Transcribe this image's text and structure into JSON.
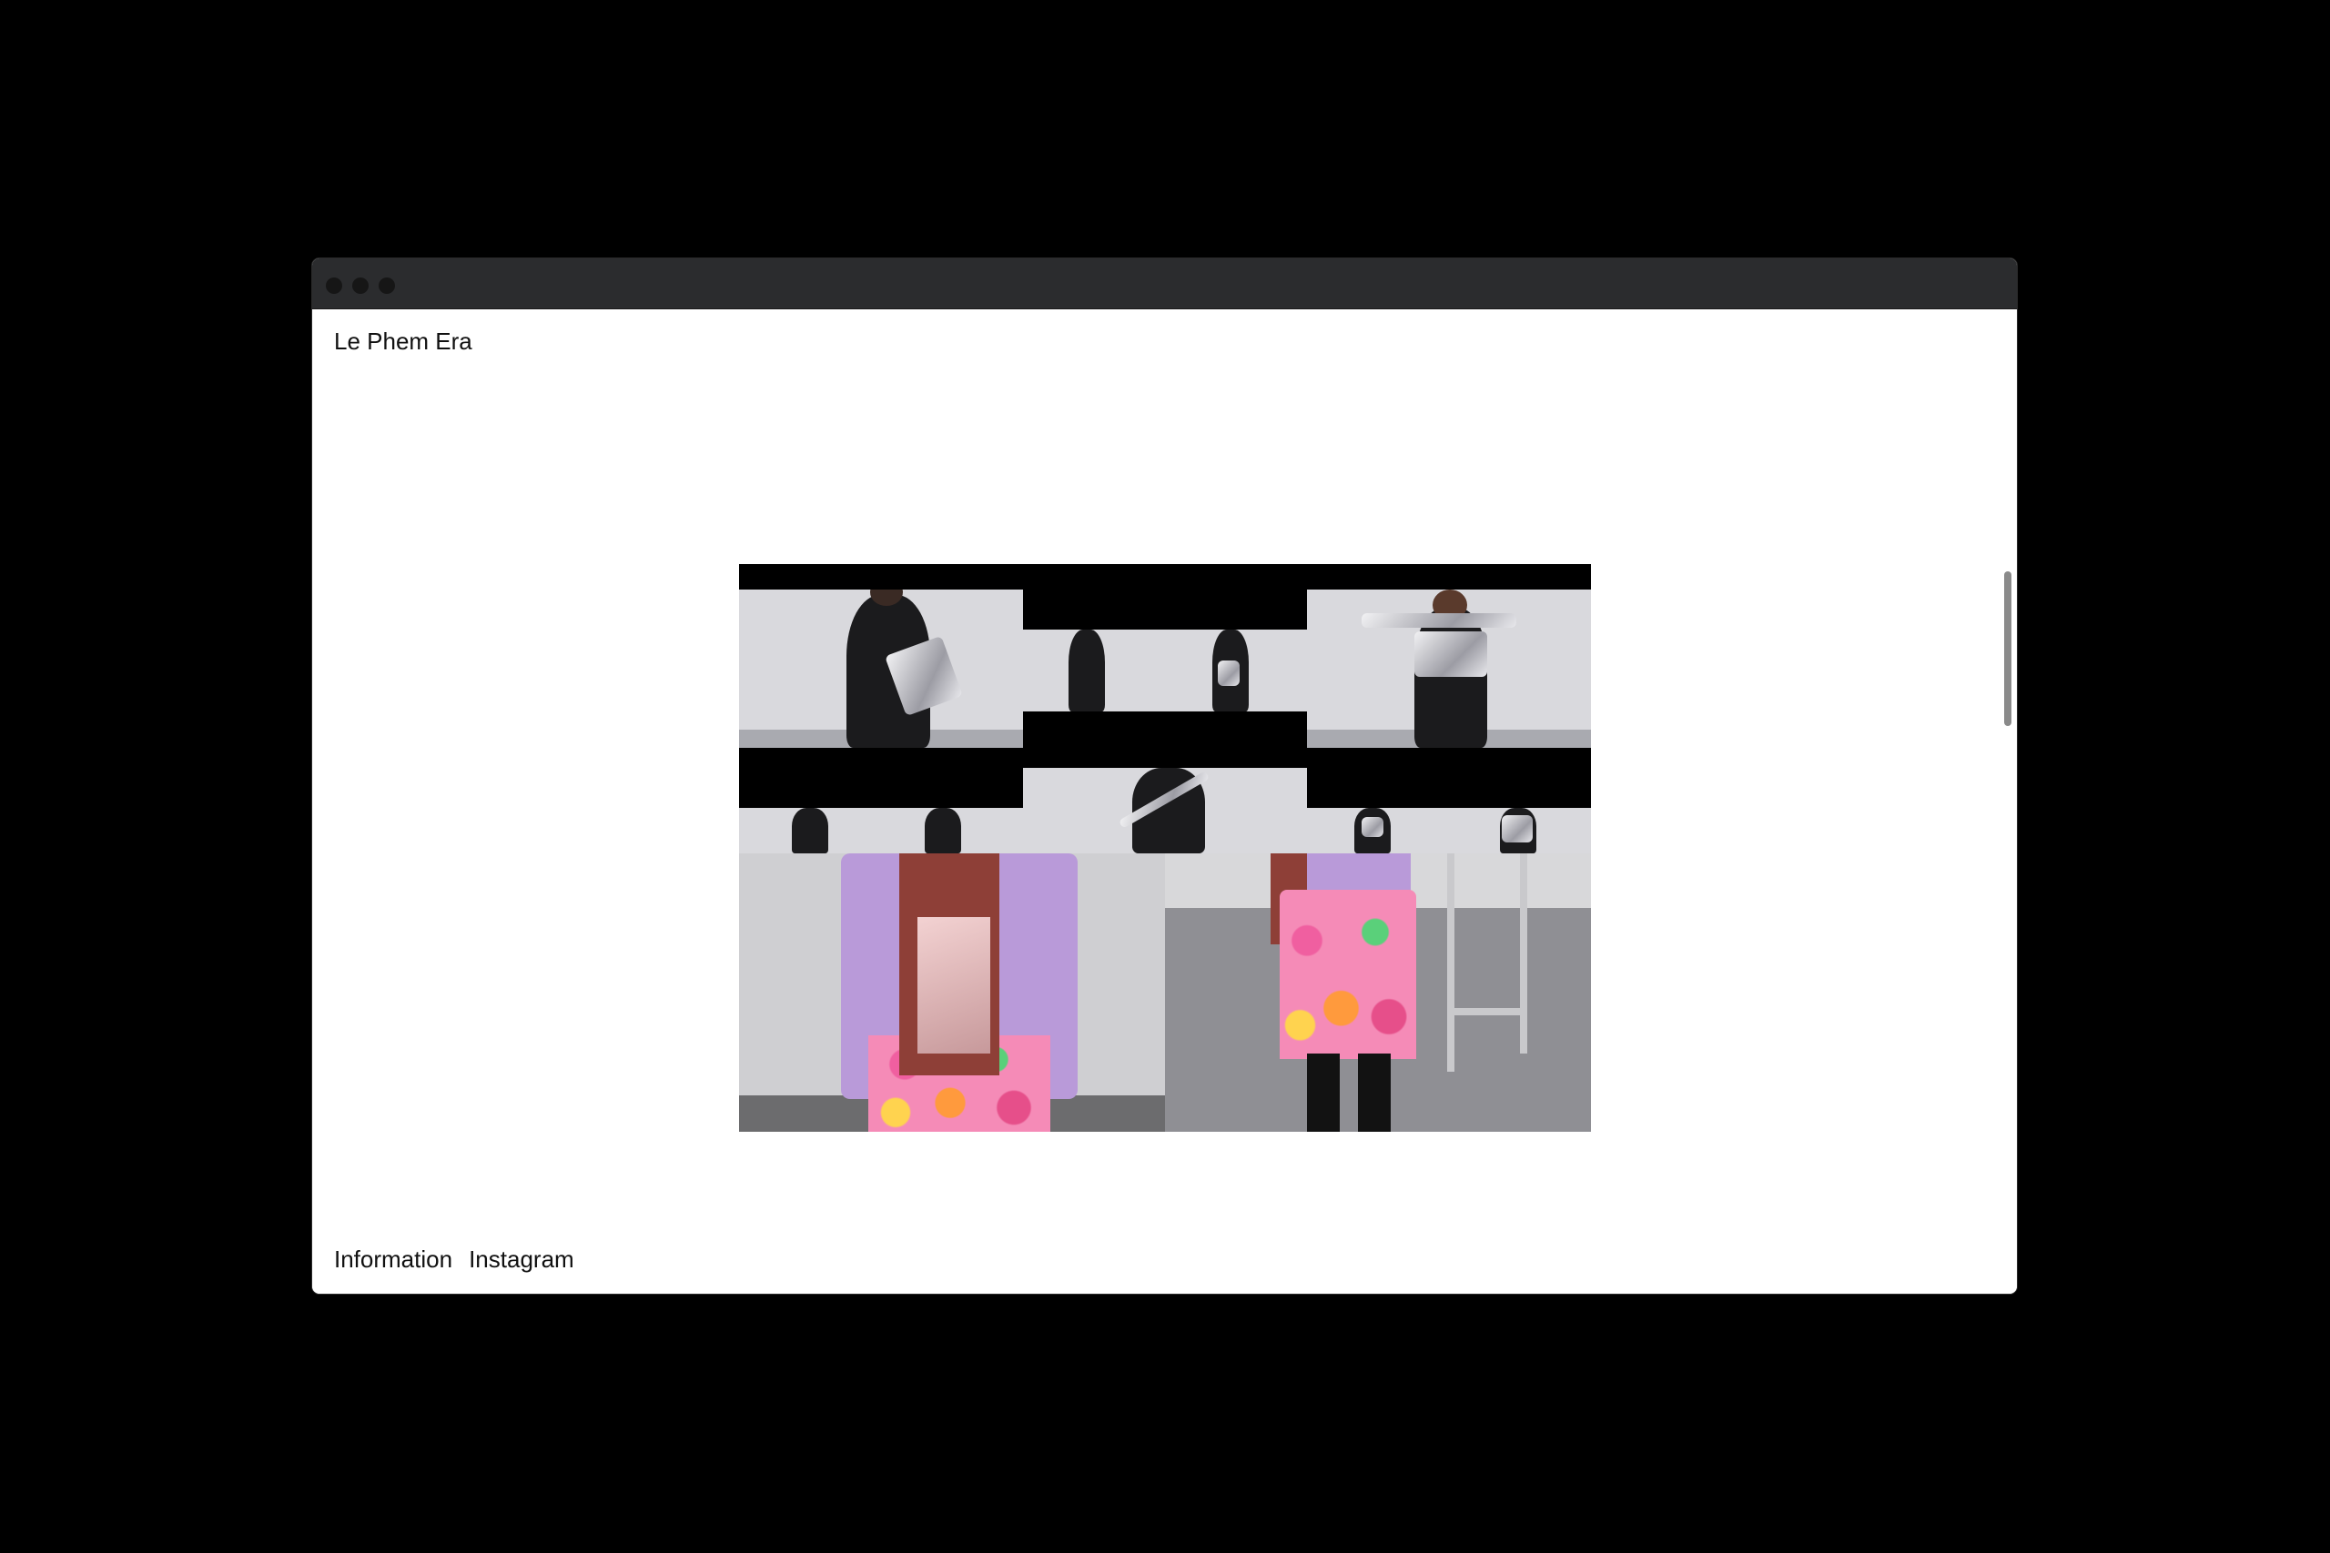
{
  "site": {
    "title": "Le Phem Era"
  },
  "hero": {
    "image_icon": "collage-image"
  },
  "footer": {
    "links": [
      {
        "label": "Information"
      },
      {
        "label": "Instagram"
      }
    ]
  },
  "colors": {
    "page_background": "#000000",
    "titlebar": "#2b2c2e",
    "content_background": "#ffffff",
    "text": "#111111",
    "scroll_thumb": "#8a8a8a"
  }
}
